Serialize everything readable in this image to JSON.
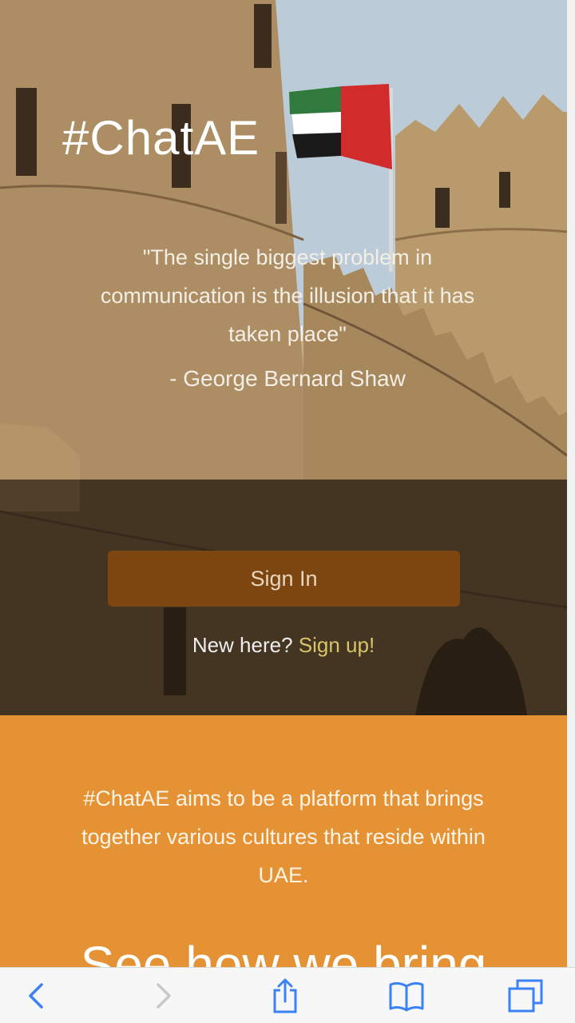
{
  "brand": "#ChatAE",
  "quote": "\"The single biggest problem in communication is the illusion that it has taken place\"",
  "author": "- George Bernard Shaw",
  "auth": {
    "signin_label": "Sign In",
    "new_here": "New here?",
    "signup_label": "Sign up!"
  },
  "about": "#ChatAE aims to be a platform that brings together various cultures that reside within UAE.",
  "headline_partial": "See how we bring",
  "toolbar": {
    "icons": [
      "back-icon",
      "forward-icon",
      "share-icon",
      "bookmarks-icon",
      "tabs-icon"
    ]
  },
  "colors": {
    "accent_orange": "#e59235",
    "signin_bg": "#7d4510",
    "signup_link": "#d8c468",
    "toolbar_icon": "#3b82f6"
  }
}
